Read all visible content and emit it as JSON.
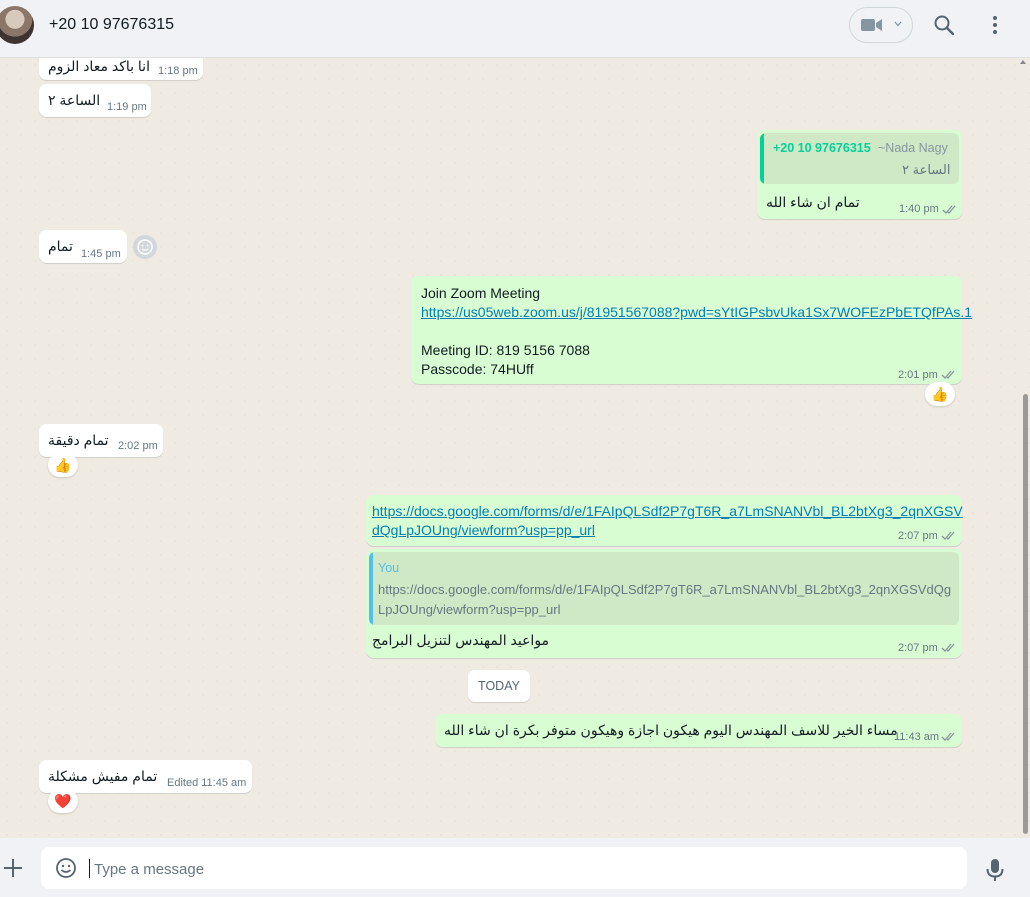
{
  "header": {
    "contact_name": "+20 10 97676315",
    "icons": [
      "video-call-icon",
      "chevron-down-icon",
      "search-icon",
      "menu-icon"
    ]
  },
  "messages": [
    {
      "dir": "in",
      "text": "انا باكد معاد الزوم",
      "time": "1:18 pm"
    },
    {
      "dir": "in",
      "text": "الساعة ٢",
      "time": "1:19 pm"
    },
    {
      "dir": "out",
      "quote_author": "+20 10 97676315",
      "quote_tag": "~Nada Nagy",
      "quote_text": "الساعة ٢",
      "text": "تمام ان شاء الله",
      "time": "1:40 pm"
    },
    {
      "dir": "in",
      "text": "تمام",
      "time": "1:45 pm"
    },
    {
      "dir": "out",
      "lines": [
        "Join Zoom Meeting",
        "https://us05web.zoom.us/j/81951567088?pwd=sYtIGPsbvUka1Sx7WOFEzPbETQfPAs.1",
        "",
        "Meeting ID: 819 5156 7088",
        "Passcode: 74HUff"
      ],
      "time": "2:01 pm",
      "reaction": "👍"
    },
    {
      "dir": "in",
      "text": "تمام دقيقة",
      "time": "2:02 pm",
      "reaction": "👍"
    },
    {
      "dir": "out",
      "link_lines": [
        "https://docs.google.com/forms/d/e/1FAIpQLSdf2P7gT6R_a7LmSNANVbl_BL2btXg3_2qnXGSV",
        "dQgLpJOUng/viewform?usp=pp_url"
      ],
      "time": "2:07 pm"
    },
    {
      "dir": "out",
      "quote_author": "You",
      "quote_lines": [
        "https://docs.google.com/forms/d/e/1FAIpQLSdf2P7gT6R_a7LmSNANVbl_BL2btXg3_2qnXGSVdQg",
        "LpJOUng/viewform?usp=pp_url"
      ],
      "text": "مواعيد المهندس لتنزيل البرامج",
      "time": "2:07 pm"
    },
    {
      "dir": "out",
      "text": "مساء الخير للاسف المهندس اليوم هيكون اجازة وهيكون متوفر بكرة ان شاء الله",
      "time": "11:43 am"
    },
    {
      "dir": "in",
      "text": "تمام مفيش مشكلة",
      "time": "Edited 11:45 am",
      "reaction": "❤️"
    }
  ],
  "date_divider": "TODAY",
  "composer": {
    "placeholder": "Type a message",
    "icons": [
      "plus-icon",
      "emoji-icon",
      "mic-icon"
    ]
  },
  "colors": {
    "incoming_bubble": "#ffffff",
    "outgoing_bubble": "#d9fdd3",
    "chat_background": "#efeae2",
    "quote_bar_contact": "#06cf9c",
    "quote_bar_self": "#53bdeb",
    "link": "#027eb5",
    "ticks": "#8696a0"
  }
}
